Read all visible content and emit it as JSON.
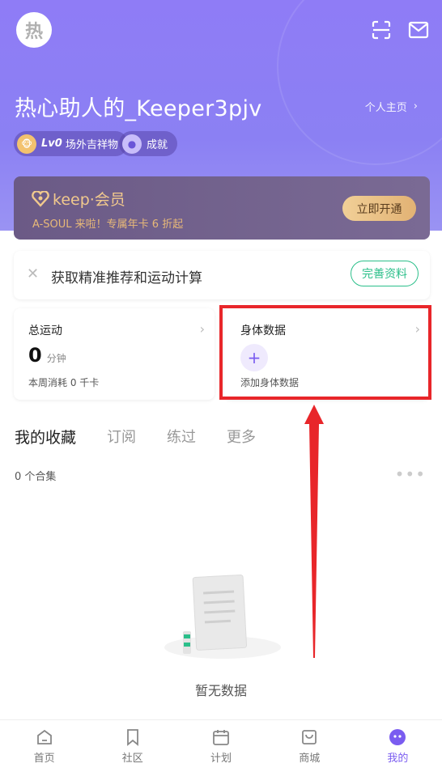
{
  "header": {
    "avatar_char": "热",
    "username": "热心助人的_Keeper3pjv",
    "profile_link": "个人主页",
    "chips": [
      {
        "level": "Lv0",
        "label": "场外吉祥物"
      },
      {
        "label": "成就"
      }
    ]
  },
  "member": {
    "logo_text": "keep·会员",
    "subtitle": "A-SOUL 来啦！专属年卡 6 折起",
    "cta": "立即开通"
  },
  "tip": {
    "text": "获取精准推荐和运动计算",
    "cta": "完善资料"
  },
  "stats": {
    "total": {
      "title": "总运动",
      "value": "0",
      "unit": "分钟",
      "sub": "本周消耗 0 千卡"
    },
    "body": {
      "title": "身体数据",
      "add_label": "添加身体数据"
    }
  },
  "tabs": [
    "我的收藏",
    "订阅",
    "练过",
    "更多"
  ],
  "collection_count": "0 个合集",
  "empty_text": "暂无数据",
  "tabbar": [
    "首页",
    "社区",
    "计划",
    "商城",
    "我的"
  ],
  "colors": {
    "accent": "#7a5cf0",
    "green": "#2bbf8a",
    "highlight": "#e8262a"
  }
}
